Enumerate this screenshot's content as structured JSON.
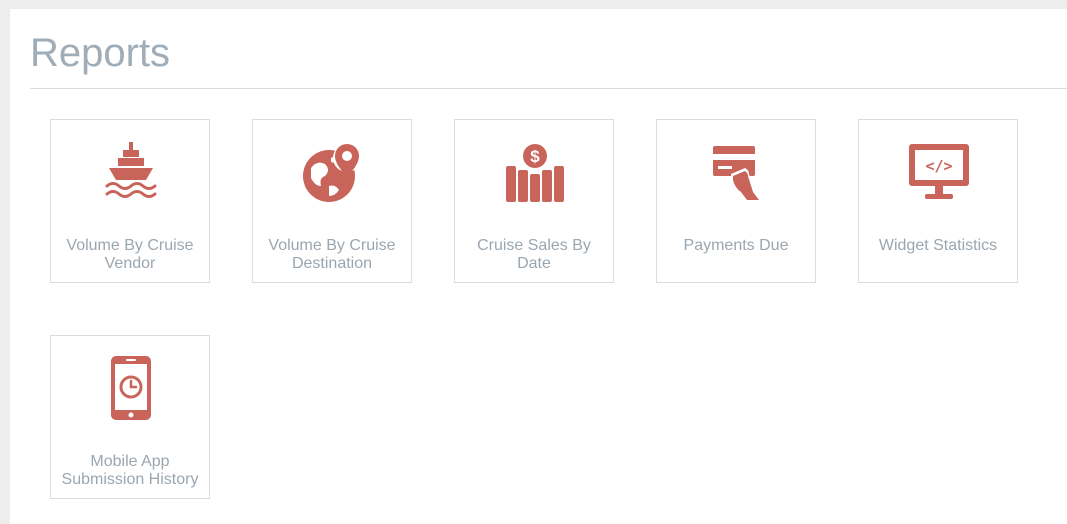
{
  "page": {
    "title": "Reports"
  },
  "colors": {
    "accent": "#c9645a",
    "title": "#9fadb8",
    "label": "#9aa6b0",
    "border": "#dcdcdc",
    "background": "#ededed"
  },
  "reports": [
    {
      "label": "Volume By Cruise Vendor",
      "icon": "cruise-ship-icon"
    },
    {
      "label": "Volume By Cruise Destination",
      "icon": "globe-pin-icon"
    },
    {
      "label": "Cruise Sales By Date",
      "icon": "dollar-bar-chart-icon"
    },
    {
      "label": "Payments Due",
      "icon": "credit-card-hand-icon"
    },
    {
      "label": "Widget Statistics",
      "icon": "monitor-code-icon"
    },
    {
      "label": "Mobile App Submission History",
      "icon": "mobile-clock-icon"
    }
  ]
}
